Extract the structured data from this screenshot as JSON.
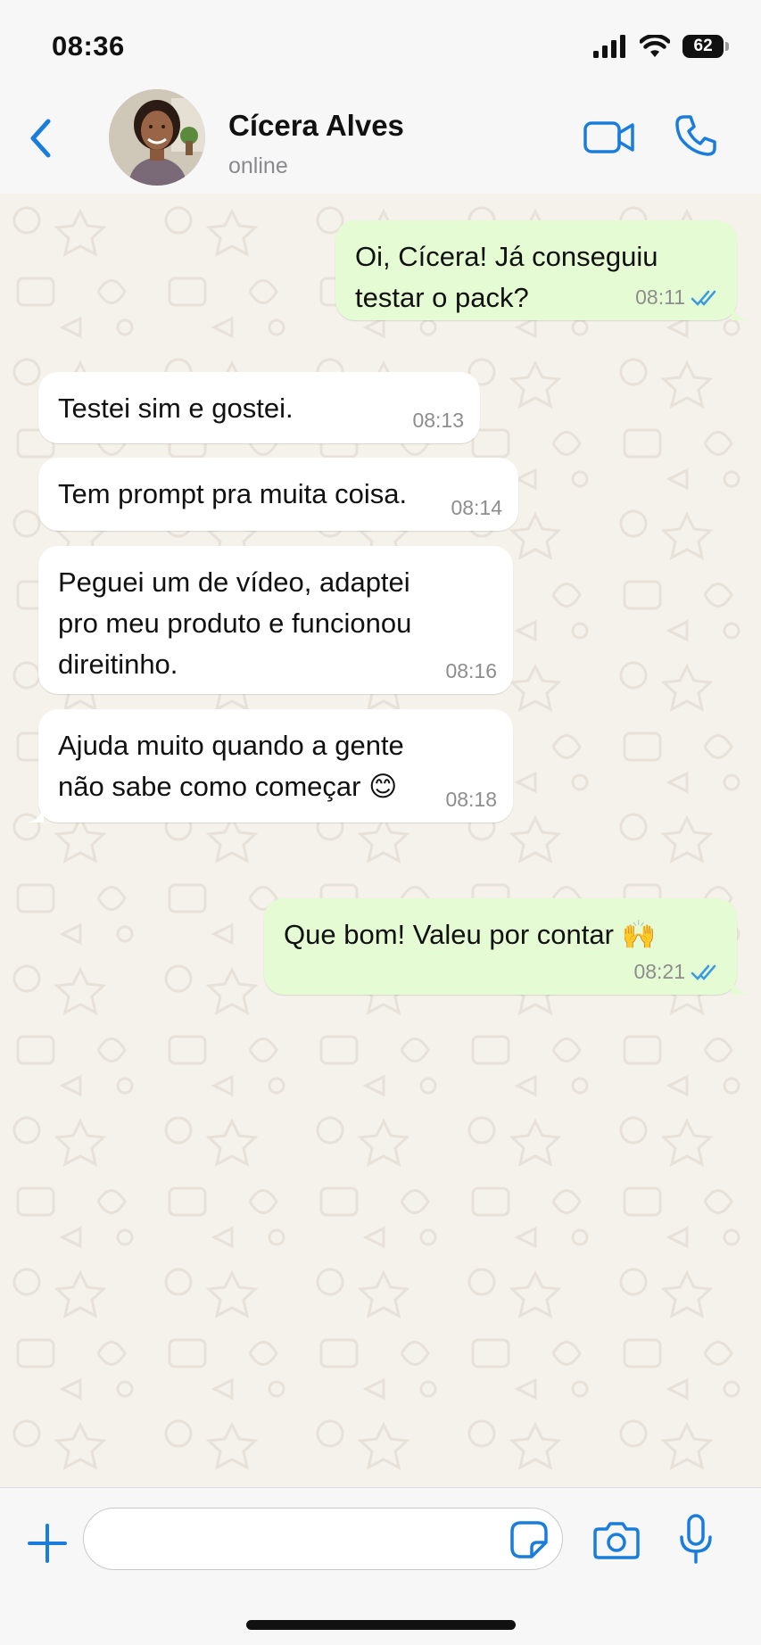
{
  "status_bar": {
    "time": "08:36",
    "battery": "62"
  },
  "contact": {
    "name": "Cícera Alves",
    "status": "online"
  },
  "messages": [
    {
      "direction": "out",
      "lines": [
        "Oi, Cícera! Já conseguiu",
        "testar o pack?"
      ],
      "time": "08:11",
      "read": true
    },
    {
      "direction": "in",
      "lines": [
        "Testei sim e gostei."
      ],
      "time": "08:13"
    },
    {
      "direction": "in",
      "lines": [
        "Tem prompt pra muita coisa."
      ],
      "time": "08:14"
    },
    {
      "direction": "in",
      "lines": [
        "Peguei um de vídeo, adaptei",
        "pro meu produto e funcionou",
        "direitinho."
      ],
      "time": "08:16"
    },
    {
      "direction": "in",
      "lines": [
        "Ajuda muito quando a gente",
        "não sabe como começar 😊"
      ],
      "time": "08:18"
    },
    {
      "direction": "out",
      "lines": [
        "Que bom! Valeu por contar 🙌"
      ],
      "time": "08:21",
      "read": true
    }
  ],
  "composer": {
    "placeholder": ""
  },
  "colors": {
    "accent": "#1a7ddb",
    "outgoing_bubble": "#e4fbd3",
    "incoming_bubble": "#ffffff",
    "read_ticks": "#3b9ae1"
  },
  "icons": {
    "back": "chevron-left-icon",
    "video": "video-camera-icon",
    "call": "phone-icon",
    "plus": "plus-icon",
    "sticker": "sticker-icon",
    "camera": "camera-icon",
    "mic": "microphone-icon",
    "read": "double-check-icon"
  }
}
